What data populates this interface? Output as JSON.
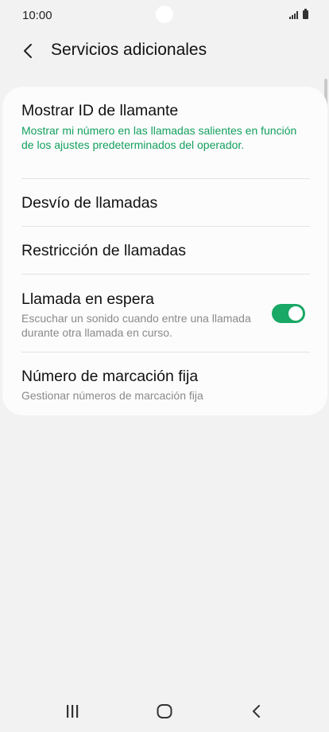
{
  "status_bar": {
    "time": "10:00",
    "icons": [
      "signal-icon",
      "battery-icon"
    ]
  },
  "header": {
    "back_icon": "chevron-left-icon",
    "title": "Servicios adicionales"
  },
  "items": [
    {
      "title": "Mostrar ID de llamante",
      "subtitle": "Mostrar mi número en las llamadas salientes en función de los ajustes predeterminados del operador."
    },
    {
      "title": "Desvío de llamadas"
    },
    {
      "title": "Restricción de llamadas"
    },
    {
      "title": "Llamada en espera",
      "subtitle": "Escuchar un sonido cuando entre una llamada durante otra llamada en curso.",
      "toggle": true
    },
    {
      "title": "Número de marcación fija",
      "subtitle": "Gestionar números de marcación fija"
    }
  ],
  "nav_bar": {
    "icons": [
      "recent-apps-icon",
      "home-icon",
      "back-icon"
    ]
  },
  "colors": {
    "accent": "#19a865",
    "subtitle_green": "#14a05e",
    "background": "#f2f2f2",
    "card": "#fcfcfc"
  }
}
